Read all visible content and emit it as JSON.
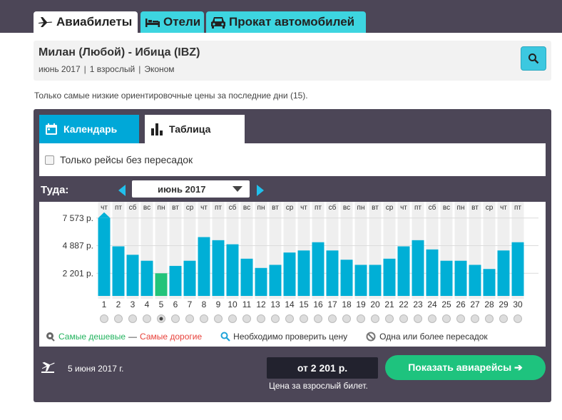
{
  "tabs": [
    {
      "label": "Авиабилеты",
      "icon": "plane-icon"
    },
    {
      "label": "Отели",
      "icon": "bed-icon"
    },
    {
      "label": "Прокат автомобилей",
      "icon": "car-icon"
    }
  ],
  "search": {
    "route": "Милан (Любой) - Ибица (IBZ)",
    "month": "июнь 2017",
    "passengers": "1 взрослый",
    "cabin": "Эконом"
  },
  "note": "Только самые низкие ориентировочные цены за последние дни (15).",
  "view_tabs": {
    "calendar": "Календарь",
    "table": "Таблица"
  },
  "filter": {
    "direct_only": "Только рейсы без пересадок",
    "checked": false
  },
  "direction": {
    "label": "Туда:",
    "month": "июнь 2017"
  },
  "chart_data": {
    "type": "bar",
    "categories": [
      "1",
      "2",
      "3",
      "4",
      "5",
      "6",
      "7",
      "8",
      "9",
      "10",
      "11",
      "12",
      "13",
      "14",
      "15",
      "16",
      "17",
      "18",
      "19",
      "20",
      "21",
      "22",
      "23",
      "24",
      "25",
      "26",
      "27",
      "28",
      "29",
      "30"
    ],
    "weekdays": [
      "чт",
      "пт",
      "сб",
      "вс",
      "пн",
      "вт",
      "ср",
      "чт",
      "пт",
      "сб",
      "вс",
      "пн",
      "вт",
      "ср",
      "чт",
      "пт",
      "сб",
      "вс",
      "пн",
      "вт",
      "ср",
      "чт",
      "пт",
      "сб",
      "вс",
      "пн",
      "вт",
      "ср",
      "чт",
      "пт"
    ],
    "values": [
      7573,
      4820,
      4000,
      3420,
      2201,
      2920,
      3420,
      5720,
      5420,
      5020,
      3620,
      2720,
      3020,
      4220,
      4420,
      5220,
      4420,
      3520,
      3020,
      3020,
      3620,
      4820,
      5420,
      4520,
      3420,
      3420,
      3020,
      2620,
      4420,
      5220
    ],
    "cheapest_index": 4,
    "selected_index": 4,
    "ytick_labels": [
      "7 573 р.",
      "4 887 р.",
      "2 201 р."
    ],
    "ytick_values": [
      7573,
      4887,
      2201
    ],
    "ylim": [
      0,
      8000
    ],
    "colors": {
      "bar": "#00afd6",
      "cheapest": "#22c47a"
    }
  },
  "legend": {
    "cheapest": "Самые дешевые",
    "dash": "—",
    "expensive": "Самые дорогие",
    "check": "Необходимо проверить цену",
    "stops": "Одна или более пересадок"
  },
  "footer": {
    "date": "5 июня 2017 г.",
    "price": "от 2 201 р.",
    "price_note": "Цена за взрослый билет.",
    "show_button": "Показать авиарейсы ➔"
  }
}
